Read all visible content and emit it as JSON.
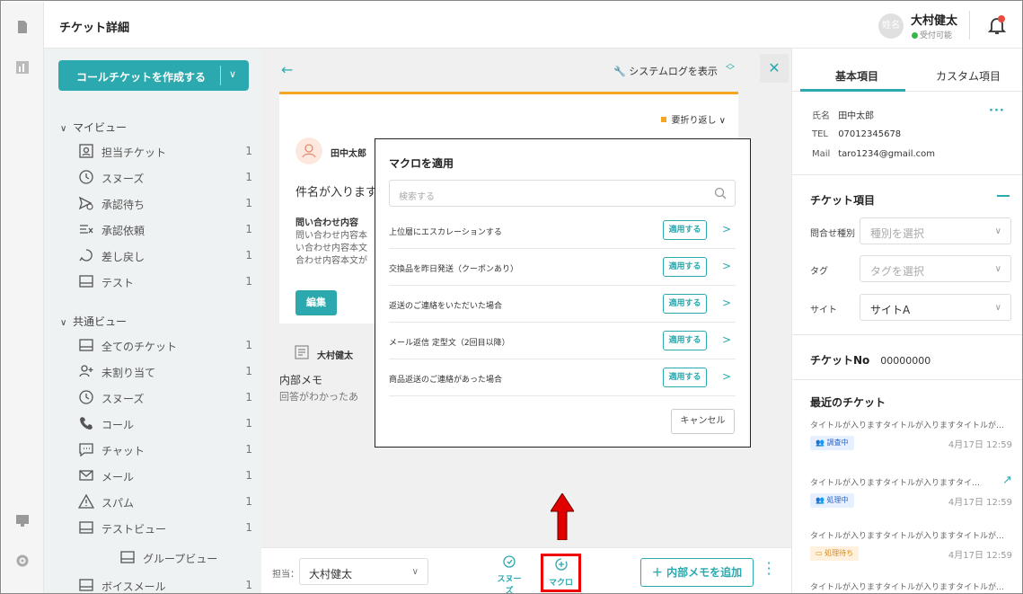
{
  "header": {
    "title": "チケット詳細",
    "avatar_text": "姓名",
    "user_name": "大村健太",
    "user_status": "受付可能"
  },
  "sidebar": {
    "create_button": "コールチケットを作成する",
    "my_view": {
      "label": "マイビュー",
      "items": [
        {
          "label": "担当チケット",
          "count": "1"
        },
        {
          "label": "スヌーズ",
          "count": "1"
        },
        {
          "label": "承認待ち",
          "count": "1"
        },
        {
          "label": "承認依頼",
          "count": "1"
        },
        {
          "label": "差し戻し",
          "count": "1"
        },
        {
          "label": "テスト",
          "count": "1"
        }
      ]
    },
    "shared_view": {
      "label": "共通ビュー",
      "items": [
        {
          "label": "全てのチケット",
          "count": "1"
        },
        {
          "label": "未割り当て",
          "count": "1"
        },
        {
          "label": "スヌーズ",
          "count": "1"
        },
        {
          "label": "コール",
          "count": "1"
        },
        {
          "label": "チャット",
          "count": "1"
        },
        {
          "label": "メール",
          "count": "1"
        },
        {
          "label": "スパム",
          "count": "1"
        },
        {
          "label": "テストビュー",
          "count": "1"
        },
        {
          "label": "グループビュー",
          "count": ""
        },
        {
          "label": "ボイスメール",
          "count": "1"
        }
      ]
    }
  },
  "ticket": {
    "system_log": "システムログを表示",
    "wrap": "要折り返し",
    "customer": "田中太郎",
    "subject": "件名が入ります",
    "inquiry_label": "問い合わせ内容",
    "inquiry_lines": [
      "問い合わせ内容本",
      "い合わせ内容本文",
      "合わせ内容本文が"
    ],
    "edit": "編集",
    "memo_author": "大村健太",
    "memo_title": "内部メモ",
    "memo_body": "回答がわかったあ"
  },
  "modal": {
    "title": "マクロを適用",
    "search_placeholder": "検索する",
    "apply_label": "適用する",
    "cancel": "キャンセル",
    "macros": [
      "上位層にエスカレーションする",
      "交換品を昨日発送（クーポンあり）",
      "返送のご連絡をいただいた場合",
      "メール返信 定型文（2回目以降）",
      "商品返送のご連絡があった場合"
    ]
  },
  "bottom": {
    "assignee_label": "担当：",
    "assignee": "大村健太",
    "snooze": "スヌーズ",
    "macro": "マクロ",
    "add_memo": "＋ 内部メモを追加"
  },
  "right": {
    "tabs": [
      "基本項目",
      "カスタム項目"
    ],
    "name_key": "氏名",
    "name": "田中太郎",
    "tel_key": "TEL",
    "tel": "07012345678",
    "mail_key": "Mail",
    "mail": "taro1234@gmail.com",
    "ticket_items": "チケット項目",
    "fields": [
      {
        "label": "問合せ種別",
        "value": "種別を選択",
        "filled": false
      },
      {
        "label": "タグ",
        "value": "タグを選択",
        "filled": false
      },
      {
        "label": "サイト",
        "value": "サイトA",
        "filled": true
      }
    ],
    "ticket_no_label": "チケットNo",
    "ticket_no": "00000000",
    "recent_label": "最近のチケット",
    "recent": [
      {
        "title": "タイトルが入りますタイトルが入りますタイトルが…",
        "status": "調査中",
        "date": "4月17日 12:59"
      },
      {
        "title": "タイトルが入りますタイトルが入りますタイ…",
        "status": "処理中",
        "date": "4月17日 12:59"
      },
      {
        "title": "タイトルが入りますタイトルが入りますタイトルが…",
        "status": "処理待ち",
        "date": "4月17日 12:59"
      },
      {
        "title": "タイトルが入りますタイトルが入りますタイトルが…",
        "status": "",
        "date": ""
      }
    ]
  },
  "colors": {
    "accent": "#2ba9ae",
    "orange": "#f5a623",
    "highlight": "#e00000"
  }
}
